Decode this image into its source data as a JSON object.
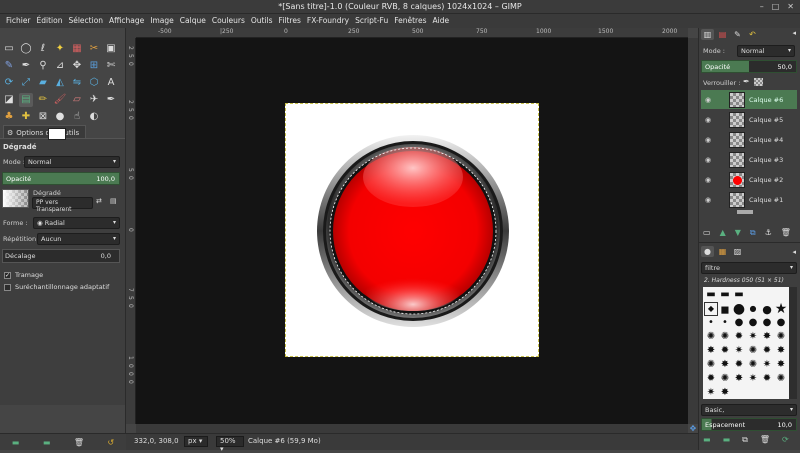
{
  "window": {
    "title": "*[Sans titre]-1.0 (Couleur RVB, 8 calques) 1024x1024 – GIMP",
    "controls": [
      "–",
      "□",
      "✕"
    ]
  },
  "menu": [
    "Fichier",
    "Édition",
    "Sélection",
    "Affichage",
    "Image",
    "Calque",
    "Couleurs",
    "Outils",
    "Filtres",
    "FX-Foundry",
    "Script-Fu",
    "Fenêtres",
    "Aide"
  ],
  "toolbox": {
    "tools": [
      {
        "icon": "rect-select-icon",
        "glyph": "▭"
      },
      {
        "icon": "ellipse-select-icon",
        "glyph": "◯"
      },
      {
        "icon": "free-select-icon",
        "glyph": "ℓ"
      },
      {
        "icon": "fuzzy-select-icon",
        "glyph": "✦",
        "color": "#f0d040"
      },
      {
        "icon": "color-select-icon",
        "glyph": "▦",
        "color": "#d86060"
      },
      {
        "icon": "scissors-icon",
        "glyph": "✂",
        "color": "#e0a040"
      },
      {
        "icon": "foreground-select-icon",
        "glyph": "▣"
      },
      {
        "icon": "paths-icon",
        "glyph": "✎",
        "color": "#80a0e0"
      },
      {
        "icon": "color-picker-icon",
        "glyph": "✒",
        "color": "#e0e0e0"
      },
      {
        "icon": "zoom-icon",
        "glyph": "⚲"
      },
      {
        "icon": "measure-icon",
        "glyph": "⊿"
      },
      {
        "icon": "move-icon",
        "glyph": "✥"
      },
      {
        "icon": "align-icon",
        "glyph": "⊞",
        "color": "#5aa0e0"
      },
      {
        "icon": "crop-icon",
        "glyph": "✄"
      },
      {
        "icon": "rotate-icon",
        "glyph": "⟳",
        "color": "#5ab0e0"
      },
      {
        "icon": "scale-icon",
        "glyph": "⤢",
        "color": "#5ab0e0"
      },
      {
        "icon": "shear-icon",
        "glyph": "▰",
        "color": "#5ab0e0"
      },
      {
        "icon": "perspective-icon",
        "glyph": "◭",
        "color": "#5ab0e0"
      },
      {
        "icon": "flip-icon",
        "glyph": "⇋",
        "color": "#5ab0e0"
      },
      {
        "icon": "cage-icon",
        "glyph": "⬡",
        "color": "#5ab0e0"
      },
      {
        "icon": "text-icon",
        "glyph": "A"
      },
      {
        "icon": "bucket-fill-icon",
        "glyph": "◪",
        "color": "#e0e0e0"
      },
      {
        "icon": "blend-icon",
        "glyph": "▤",
        "color": "#5ab080"
      },
      {
        "icon": "pencil-icon",
        "glyph": "✏",
        "color": "#e0c040"
      },
      {
        "icon": "paintbrush-icon",
        "glyph": "🖌",
        "color": "#d06060"
      },
      {
        "icon": "eraser-icon",
        "glyph": "▱",
        "color": "#e08080"
      },
      {
        "icon": "airbrush-icon",
        "glyph": "✈",
        "color": "#e0e0e0"
      },
      {
        "icon": "ink-icon",
        "glyph": "✒",
        "color": "#e0e0e0"
      },
      {
        "icon": "clone-icon",
        "glyph": "♣",
        "color": "#e0a040"
      },
      {
        "icon": "heal-icon",
        "glyph": "✚",
        "color": "#e0c040"
      },
      {
        "icon": "perspective-clone-icon",
        "glyph": "⊠"
      },
      {
        "icon": "blur-icon",
        "glyph": "●",
        "color": "#e0e0e0"
      },
      {
        "icon": "smudge-icon",
        "glyph": "☝"
      },
      {
        "icon": "dodge-icon",
        "glyph": "◐"
      },
      {
        "icon": "empty-icon",
        "glyph": ""
      }
    ],
    "options_tab": "Options des outils",
    "tool_name": "Dégradé",
    "mode_label": "Mode :",
    "mode_value": "Normal",
    "opacity_label": "Opacité",
    "opacity_value": "100,0",
    "gradient_label": "Dégradé",
    "gradient_value": "PP vers Transparent",
    "shape_label": "Forme :",
    "shape_value": "Radial",
    "repeat_label": "Répétition :",
    "repeat_value": "Aucun",
    "offset_label": "Décalage",
    "offset_value": "0,0",
    "dither_label": "Tramage",
    "supersample_label": "Suréchantillonnage adaptatif"
  },
  "rulers": {
    "h_ticks": [
      "-500",
      "|250",
      "0",
      "250",
      "500",
      "750",
      "1000",
      "1250",
      "1500",
      "1750",
      "2000"
    ],
    "v_ticks": [
      "2",
      "5",
      "0",
      "2",
      "5",
      "0",
      "5",
      "0",
      "0",
      "7",
      "5",
      "0",
      "1",
      "0",
      "0",
      "0"
    ]
  },
  "status": {
    "coords": "332,0, 308,0",
    "unit": "px",
    "zoom": "50%",
    "layer_info": "Calque #6 (59,9 Mo)"
  },
  "dock": {
    "mode_label": "Mode :",
    "mode_value": "Normal",
    "opacity_label": "Opacité",
    "opacity_value": "50,0",
    "lock_label": "Verrouiller :",
    "layers": [
      "Calque #6",
      "Calque #5",
      "Calque #4",
      "Calque #3",
      "Calque #2",
      "Calque #1"
    ],
    "brush_filter": "filtre",
    "brush_name": "2. Hardness 050 (51 × 51)",
    "brush_tag": "Basic,",
    "spacing_label": "Espacement",
    "spacing_value": "10,0"
  },
  "colors": {
    "accent": "#4b7a52",
    "ball_red": "#ff0000",
    "canvas_bg": "#141414"
  }
}
